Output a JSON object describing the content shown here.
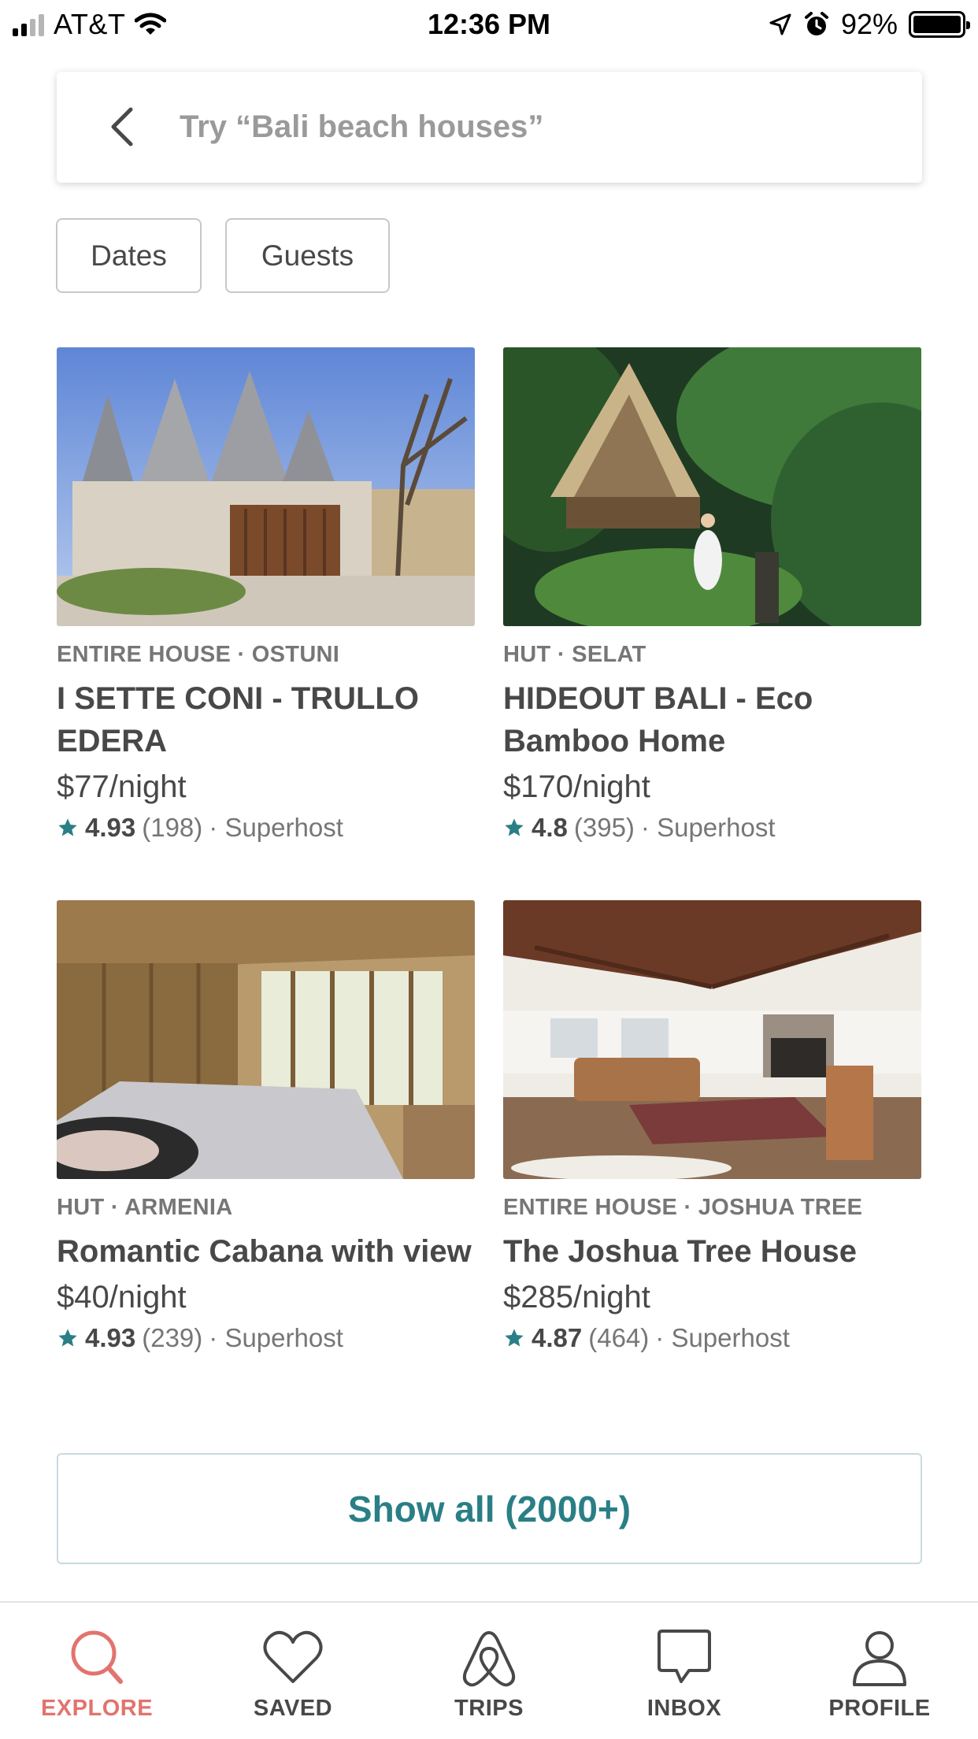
{
  "status_bar": {
    "carrier": "AT&T",
    "time": "12:36 PM",
    "battery": "92%",
    "battery_level": 0.92
  },
  "search": {
    "placeholder": "Try “Bali beach houses”",
    "back_icon": "chevron-left-icon"
  },
  "filters": [
    {
      "label": "Dates"
    },
    {
      "label": "Guests"
    }
  ],
  "listings": [
    {
      "kicker": "ENTIRE HOUSE · OSTUNI",
      "title": "I SETTE CONI - TRULLO EDERA",
      "price": "$77/night",
      "score": "4.93",
      "reviews": "(198)",
      "badge": "· Superhost"
    },
    {
      "kicker": "HUT · SELAT",
      "title": "HIDEOUT BALI - Eco Bamboo Home",
      "price": "$170/night",
      "score": "4.8",
      "reviews": "(395)",
      "badge": "· Superhost"
    },
    {
      "kicker": "HUT · ARMENIA",
      "title": "Romantic Cabana with view",
      "price": "$40/night",
      "score": "4.93",
      "reviews": "(239)",
      "badge": "· Superhost"
    },
    {
      "kicker": "ENTIRE HOUSE · JOSHUA TREE",
      "title": "The Joshua Tree House",
      "price": "$285/night",
      "score": "4.87",
      "reviews": "(464)",
      "badge": "· Superhost"
    }
  ],
  "show_all": "Show all (2000+)",
  "tabs": [
    {
      "label": "EXPLORE",
      "icon": "search-icon",
      "active": true
    },
    {
      "label": "SAVED",
      "icon": "heart-icon"
    },
    {
      "label": "TRIPS",
      "icon": "airbnb-logo-icon"
    },
    {
      "label": "INBOX",
      "icon": "message-icon"
    },
    {
      "label": "PROFILE",
      "icon": "person-icon"
    }
  ],
  "colors": {
    "accent": "#e2736e",
    "teal": "#2a7f86",
    "star": "#2a7f86",
    "text": "#484848",
    "muted": "#767676"
  }
}
